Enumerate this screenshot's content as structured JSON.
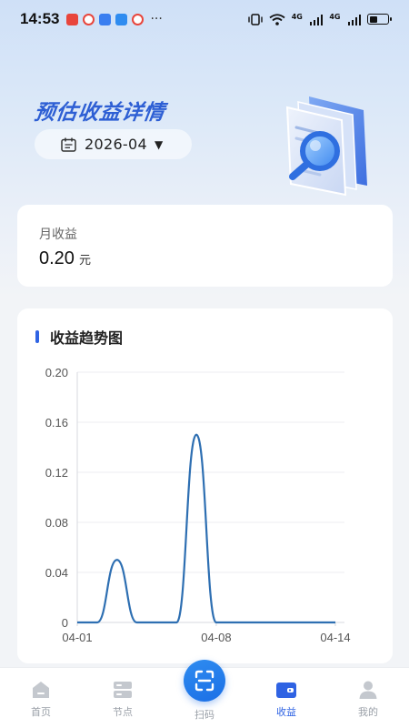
{
  "status_bar": {
    "time": "14:53",
    "more": "···",
    "network_a": "4G",
    "network_b": "4G",
    "battery_level": 0.45,
    "notification_icons": [
      "app-red-icon",
      "weibo-icon",
      "app-blue-icon",
      "shield-check-icon",
      "weibo-icon"
    ]
  },
  "header": {
    "title": "预估收益详情",
    "month": "2026-04"
  },
  "month_card": {
    "label": "月收益",
    "value": "0.20",
    "unit": "元"
  },
  "chart_section": {
    "title": "收益趋势图"
  },
  "chart_data": {
    "type": "line",
    "title": "收益趋势图",
    "x_ticks": [
      "04-01",
      "04-08",
      "04-14"
    ],
    "y_ticks": [
      "0.20",
      "0.16",
      "0.12",
      "0.08",
      "0.04",
      "0"
    ],
    "ylim": [
      0,
      0.2
    ],
    "grid": true,
    "series": [
      {
        "color": "#2e6fb2",
        "x": [
          "04-01",
          "04-02",
          "04-03",
          "04-04",
          "04-05",
          "04-06",
          "04-07",
          "04-08",
          "04-09",
          "04-10",
          "04-11",
          "04-12",
          "04-13",
          "04-14"
        ],
        "values": [
          0,
          0,
          0.05,
          0,
          0,
          0,
          0.15,
          0,
          0,
          0,
          0,
          0,
          0,
          0
        ]
      }
    ]
  },
  "tab_bar": {
    "tabs": [
      {
        "label": "首页",
        "icon": "home-icon"
      },
      {
        "label": "节点",
        "icon": "server-icon"
      },
      {
        "label": "扫码",
        "icon": "scan-icon"
      },
      {
        "label": "收益",
        "icon": "wallet-icon"
      },
      {
        "label": "我的",
        "icon": "user-icon"
      }
    ],
    "active_color": "#2f63e3",
    "inactive_color": "#c4c8ce"
  }
}
